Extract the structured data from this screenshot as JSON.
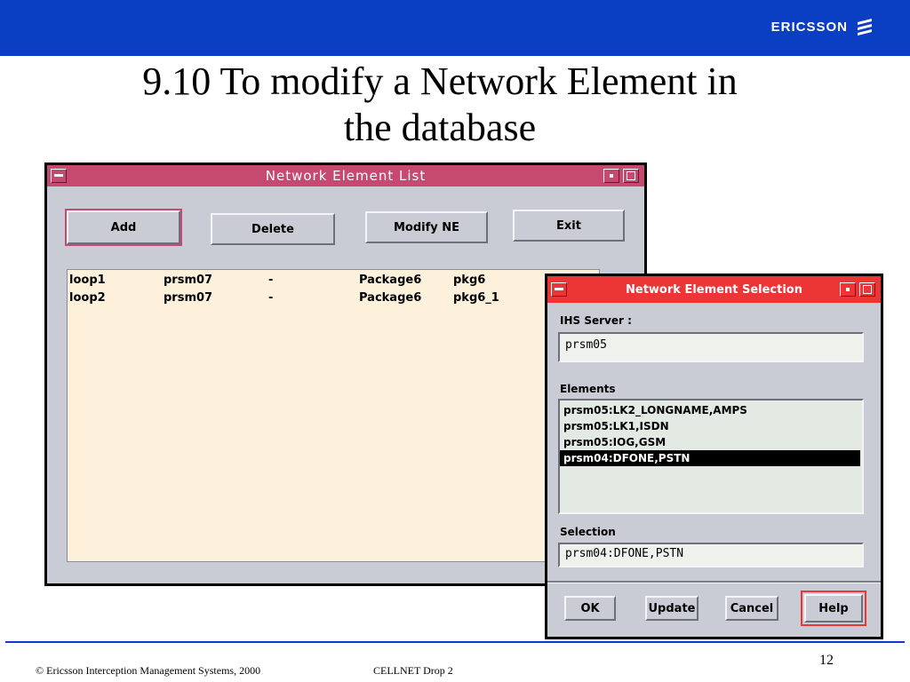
{
  "header": {
    "brand": "ERICSSON",
    "brand_logo": "ericsson-logo-icon",
    "brand_color": "#0a3fc4"
  },
  "slide": {
    "title_line1": "9.10 To modify a Network Element in",
    "title_line2": "the database",
    "page_number": "12"
  },
  "nel_window": {
    "title": "Network Element List",
    "titlebar_color": "#c64a70",
    "buttons": {
      "add": "Add",
      "delete": "Delete",
      "modify": "Modify NE",
      "exit": "Exit"
    },
    "rows": [
      [
        "loop1",
        "prsm07",
        "-",
        "Package6",
        "pkg6"
      ],
      [
        "loop2",
        "prsm07",
        "-",
        "Package6",
        "pkg6_1"
      ]
    ]
  },
  "nes_dialog": {
    "title": "Network Element Selection",
    "titlebar_color": "#ec3535",
    "ihs_server_label": "IHS Server :",
    "ihs_server_value": "prsm05",
    "elements_label": "Elements",
    "elements": [
      "prsm05:LK2_LONGNAME,AMPS",
      "prsm05:LK1,ISDN",
      "prsm05:IOG,GSM",
      "prsm04:DFONE,PSTN"
    ],
    "selected_index": 3,
    "selection_label": "Selection",
    "selection_value": "prsm04:DFONE,PSTN",
    "buttons": {
      "ok": "OK",
      "update": "Update",
      "cancel": "Cancel",
      "help": "Help"
    }
  },
  "footer": {
    "copyright": "© Ericsson Interception Management Systems, 2000",
    "project": "CELLNET Drop 2"
  }
}
